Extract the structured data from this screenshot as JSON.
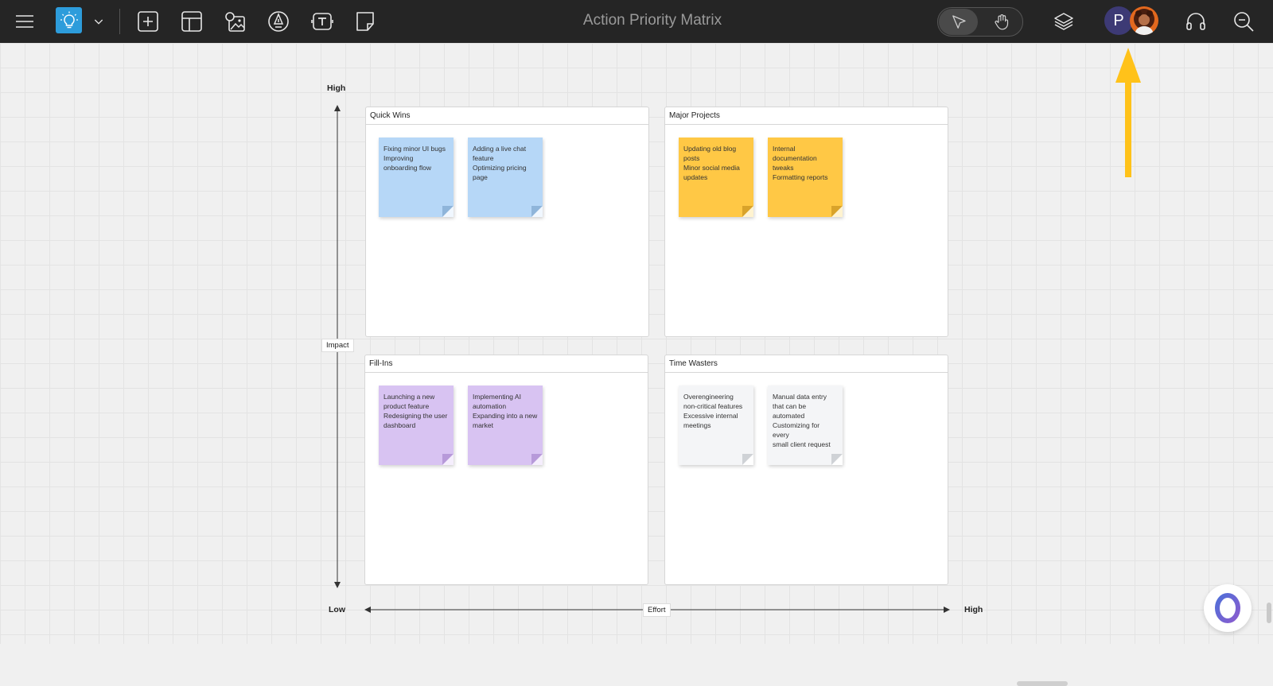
{
  "toolbar": {
    "title": "Action Priority Matrix",
    "avatar_initial": "P"
  },
  "axes": {
    "y_high": "High",
    "y_label": "Impact",
    "x_low": "Low",
    "x_label": "Effort",
    "x_high": "High"
  },
  "quadrants": {
    "quick_wins": {
      "title": "Quick Wins",
      "notes": [
        {
          "lines": [
            "Fixing minor UI bugs",
            "Improving",
            "onboarding flow"
          ]
        },
        {
          "lines": [
            "Adding a live chat",
            "feature",
            "Optimizing pricing",
            "page"
          ]
        }
      ]
    },
    "major_projects": {
      "title": "Major Projects",
      "notes": [
        {
          "lines": [
            "Updating old blog",
            "posts",
            "Minor social media",
            "updates"
          ]
        },
        {
          "lines": [
            "Internal",
            "documentation tweaks",
            "Formatting reports"
          ]
        }
      ]
    },
    "fill_ins": {
      "title": "Fill-Ins",
      "notes": [
        {
          "lines": [
            "Launching a new",
            "product feature",
            "Redesigning the user",
            "dashboard"
          ]
        },
        {
          "lines": [
            "Implementing AI",
            "automation",
            "Expanding into a new",
            "market"
          ]
        }
      ]
    },
    "time_wasters": {
      "title": "Time Wasters",
      "notes": [
        {
          "lines": [
            "Overengineering",
            "non-critical features",
            "Excessive internal",
            "meetings"
          ]
        },
        {
          "lines": [
            "Manual data entry",
            "that can be",
            "automated",
            "Customizing for every",
            "small client request"
          ]
        }
      ]
    }
  },
  "colors": {
    "toolbar_bg": "#252525",
    "accent_blue": "#2d9cdb",
    "note_blue": "#b6d7f7",
    "note_yellow": "#ffc845",
    "note_purple": "#d8c3f2",
    "note_grey": "#f4f5f7",
    "annotation_arrow": "#ffc21a"
  }
}
